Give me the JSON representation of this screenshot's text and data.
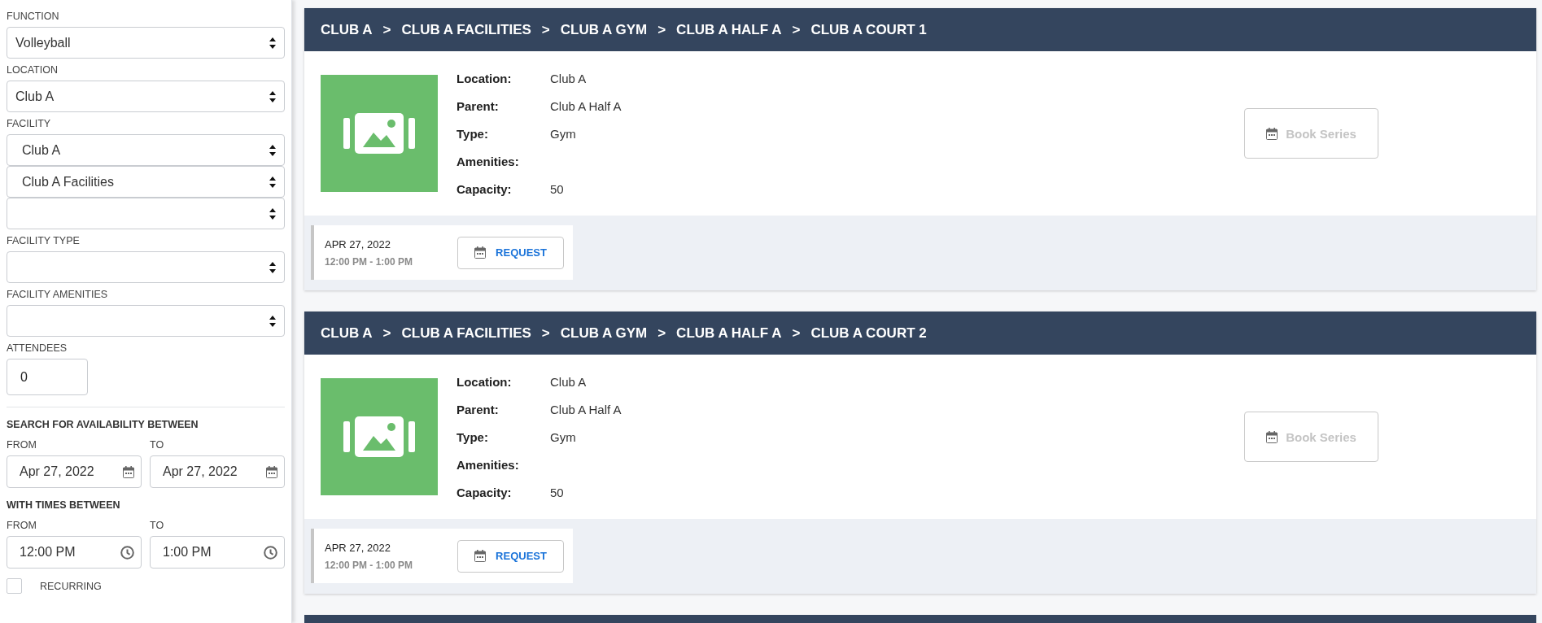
{
  "sidebar": {
    "fields": [
      {
        "kind": "select",
        "label": "FUNCTION",
        "value": "Volleyball"
      },
      {
        "kind": "select",
        "label": "LOCATION",
        "value": "Club A"
      },
      {
        "kind": "select",
        "label": "FACILITY",
        "value": "Club A",
        "inset": true
      },
      {
        "kind": "select",
        "value": "Club A Facilities",
        "inset": true
      },
      {
        "kind": "select"
      },
      {
        "kind": "select",
        "label": "FACILITY TYPE"
      },
      {
        "kind": "select",
        "label": "FACILITY AMENITIES"
      },
      {
        "kind": "number",
        "label": "ATTENDEES",
        "value": "0"
      }
    ],
    "ranges": [
      {
        "kind": "date",
        "title": "SEARCH FOR AVAILABILITY BETWEEN",
        "from": {
          "label": "FROM",
          "value": "Apr 27, 2022"
        },
        "to": {
          "label": "TO",
          "value": "Apr 27, 2022"
        }
      },
      {
        "kind": "time",
        "title": "WITH TIMES BETWEEN",
        "from": {
          "label": "FROM",
          "value": "12:00 PM"
        },
        "to": {
          "label": "TO",
          "value": "1:00 PM"
        }
      }
    ],
    "recurring": {
      "label": "RECURRING",
      "checked": false
    }
  },
  "cards": [
    {
      "kind": "full",
      "separator": ">",
      "breadcrumb": [
        "CLUB A",
        "CLUB A FACILITIES",
        "CLUB A GYM",
        "CLUB A HALF A",
        "CLUB A COURT 1"
      ],
      "details": [
        {
          "label": "Location:",
          "value": "Club A"
        },
        {
          "label": "Parent:",
          "value": "Club A Half A"
        },
        {
          "label": "Type:",
          "value": "Gym"
        },
        {
          "label": "Amenities:"
        },
        {
          "label": "Capacity:",
          "value": "50"
        }
      ],
      "book_button": {
        "label": "Book Series",
        "disabled": true
      },
      "slots": [
        {
          "date": "APR 27, 2022",
          "time": "12:00 PM - 1:00 PM",
          "button": "REQUEST"
        }
      ]
    },
    {
      "kind": "full",
      "separator": ">",
      "breadcrumb": [
        "CLUB A",
        "CLUB A FACILITIES",
        "CLUB A GYM",
        "CLUB A HALF A",
        "CLUB A COURT 2"
      ],
      "details": [
        {
          "label": "Location:",
          "value": "Club A"
        },
        {
          "label": "Parent:",
          "value": "Club A Half A"
        },
        {
          "label": "Type:",
          "value": "Gym"
        },
        {
          "label": "Amenities:"
        },
        {
          "label": "Capacity:",
          "value": "50"
        }
      ],
      "book_button": {
        "label": "Book Series",
        "disabled": true
      },
      "slots": [
        {
          "date": "APR 27, 2022",
          "time": "12:00 PM - 1:00 PM",
          "button": "REQUEST"
        }
      ]
    },
    {
      "kind": "cut"
    }
  ]
}
